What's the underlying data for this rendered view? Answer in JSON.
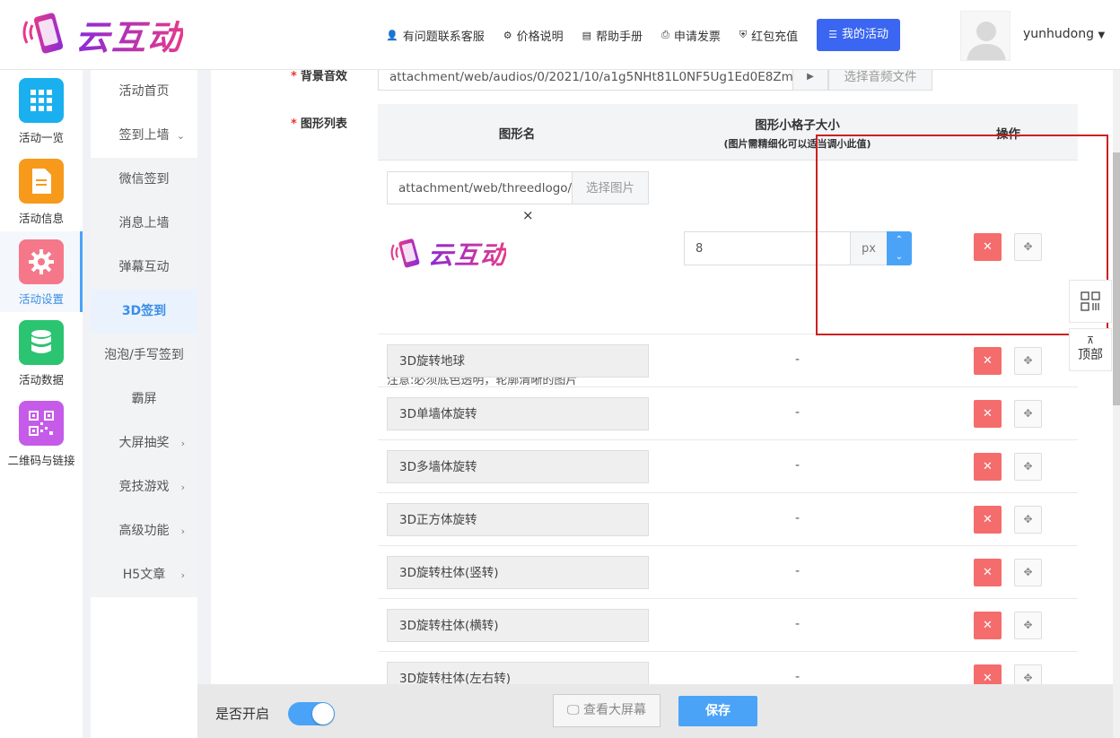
{
  "brand": {
    "name": "云互动"
  },
  "header": {
    "nav": [
      {
        "icon": "user-plus-icon",
        "label": "有问题联系客服"
      },
      {
        "icon": "gear-icon",
        "label": "价格说明"
      },
      {
        "icon": "book-icon",
        "label": "帮助手册"
      },
      {
        "icon": "printer-icon",
        "label": "申请发票"
      },
      {
        "icon": "shield-icon",
        "label": "红包充值"
      }
    ],
    "active_nav": "我的活动",
    "username": "yunhudong"
  },
  "left_rail": [
    {
      "label": "活动一览",
      "icon": "grid-icon",
      "color": "#1ab0ef"
    },
    {
      "label": "活动信息",
      "icon": "document-icon",
      "color": "#f79a1b"
    },
    {
      "label": "活动设置",
      "icon": "gear-icon",
      "color": "#f5788a",
      "active": true
    },
    {
      "label": "活动数据",
      "icon": "database-icon",
      "color": "#2bc470"
    },
    {
      "label": "二维码与链接",
      "icon": "qrcode-icon",
      "color": "#c55be8"
    }
  ],
  "sub_nav": [
    {
      "label": "活动首页"
    },
    {
      "label": "签到上墙",
      "arrow": "⌄"
    },
    {
      "label": "微信签到"
    },
    {
      "label": "消息上墙"
    },
    {
      "label": "弹幕互动"
    },
    {
      "label": "3D签到",
      "active": true
    },
    {
      "label": "泡泡/手写签到"
    },
    {
      "label": "霸屏"
    },
    {
      "label": "大屏抽奖",
      "arrow": "›"
    },
    {
      "label": "竞技游戏",
      "arrow": "›"
    },
    {
      "label": "高级功能",
      "arrow": "›"
    },
    {
      "label": "H5文章",
      "arrow": "›"
    }
  ],
  "form": {
    "audio_label": "背景音效",
    "audio_path": "attachment/web/audios/0/2021/10/a1g5NHt81L0NF5Ug1Ed0E8ZmhE5",
    "audio_pick": "选择音频文件",
    "list_label": "图形列表",
    "table": {
      "col_name": "图形名",
      "col_size": "图形小格子大小",
      "col_size_note": "(图片需精细化可以适当调小此值)",
      "col_action": "操作",
      "image_path": "attachment/web/threedlogo/",
      "image_pick": "选择图片",
      "close": "×",
      "logo_text": "云互动",
      "size_value": "8",
      "size_unit": "px",
      "note": "注意:必须底色透明，轮廓清晰的图片",
      "rows": [
        {
          "name": "3D旋转地球",
          "size": "-"
        },
        {
          "name": "3D单墙体旋转",
          "size": "-"
        },
        {
          "name": "3D多墙体旋转",
          "size": "-"
        },
        {
          "name": "3D正方体旋转",
          "size": "-"
        },
        {
          "name": "3D旋转柱体(竖转)",
          "size": "-"
        },
        {
          "name": "3D旋转柱体(横转)",
          "size": "-"
        },
        {
          "name": "3D旋转柱体(左右转)",
          "size": "-"
        }
      ]
    }
  },
  "float": {
    "top_label": "顶部"
  },
  "footer": {
    "enable_label": "是否开启",
    "enabled": true,
    "preview": "查看大屏幕",
    "save": "保存"
  }
}
